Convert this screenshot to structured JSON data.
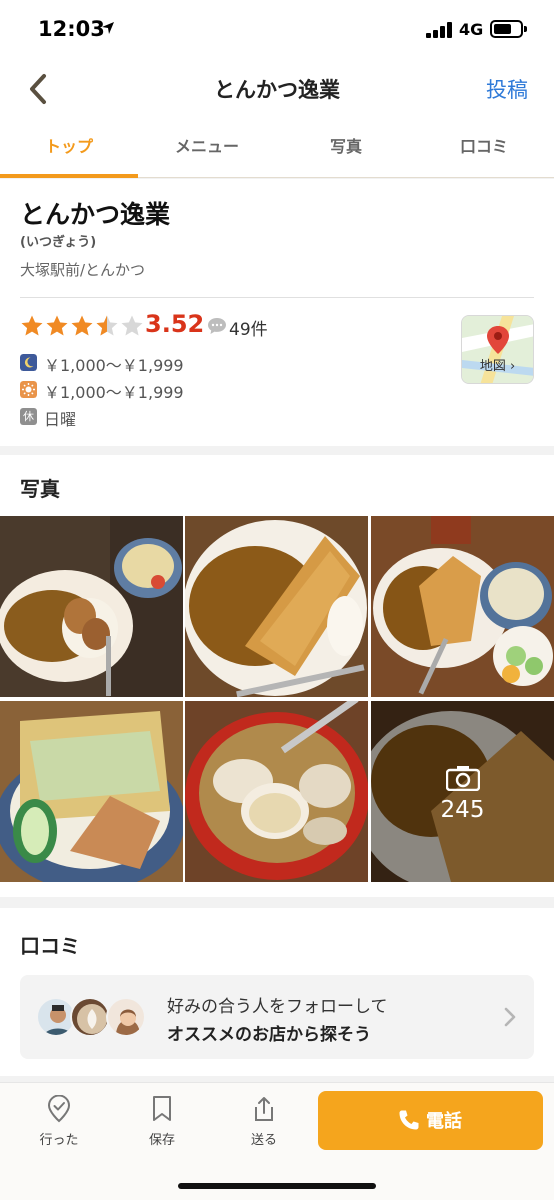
{
  "status_bar": {
    "time": "12:03",
    "network": "4G"
  },
  "nav": {
    "title": "とんかつ逸業",
    "post_label": "投稿"
  },
  "tabs": [
    {
      "label": "トップ"
    },
    {
      "label": "メニュー"
    },
    {
      "label": "写真"
    },
    {
      "label": "口コミ"
    }
  ],
  "restaurant": {
    "name": "とんかつ逸業",
    "reading": "(いつぎょう)",
    "area": "大塚駅前/とんかつ",
    "rating": "3.52",
    "rating_value": 3.52,
    "review_count": "49件",
    "dinner_price": "￥1,000～￥1,999",
    "lunch_price": "￥1,000～￥1,999",
    "holiday_badge": "休",
    "holiday": "日曜",
    "map_label": "地図 ›"
  },
  "photos": {
    "title": "写真",
    "count": "245"
  },
  "reviews": {
    "title": "口コミ",
    "follow_line1": "好みの合う人をフォローして",
    "follow_line2": "オススメのお店から探そう"
  },
  "bottom_bar": {
    "went_label": "行った",
    "save_label": "保存",
    "send_label": "送る",
    "call_label": "電話"
  },
  "colors": {
    "accent": "#f39a1c",
    "rating_red": "#d9341a",
    "link_blue": "#2f7ad8",
    "call_button": "#f5a51d"
  }
}
